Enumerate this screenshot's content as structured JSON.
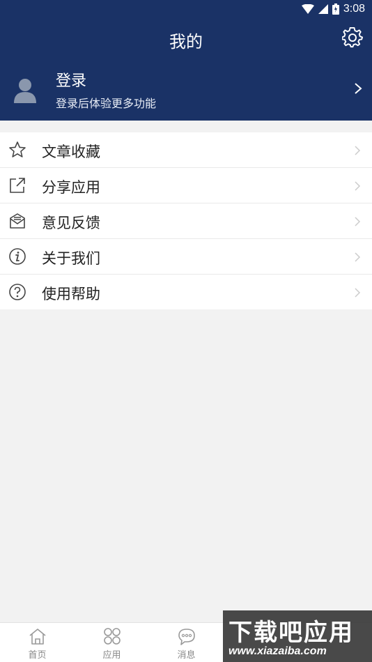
{
  "status_bar": {
    "time": "3:08"
  },
  "header": {
    "title": "我的"
  },
  "profile": {
    "name": "登录",
    "subtitle": "登录后体验更多功能"
  },
  "menu": {
    "items": [
      {
        "label": "文章收藏",
        "icon": "star-icon"
      },
      {
        "label": "分享应用",
        "icon": "share-icon"
      },
      {
        "label": "意见反馈",
        "icon": "feedback-icon"
      },
      {
        "label": "关于我们",
        "icon": "info-icon"
      },
      {
        "label": "使用帮助",
        "icon": "help-icon"
      }
    ]
  },
  "tabbar": {
    "items": [
      {
        "label": "首页",
        "icon": "home-icon"
      },
      {
        "label": "应用",
        "icon": "apps-icon"
      },
      {
        "label": "消息",
        "icon": "message-icon"
      }
    ]
  },
  "watermark": {
    "main": "下载吧应用",
    "url": "www.xiazaiba.com"
  },
  "colors": {
    "header": "#1a3266",
    "background": "#f2f2f2"
  }
}
